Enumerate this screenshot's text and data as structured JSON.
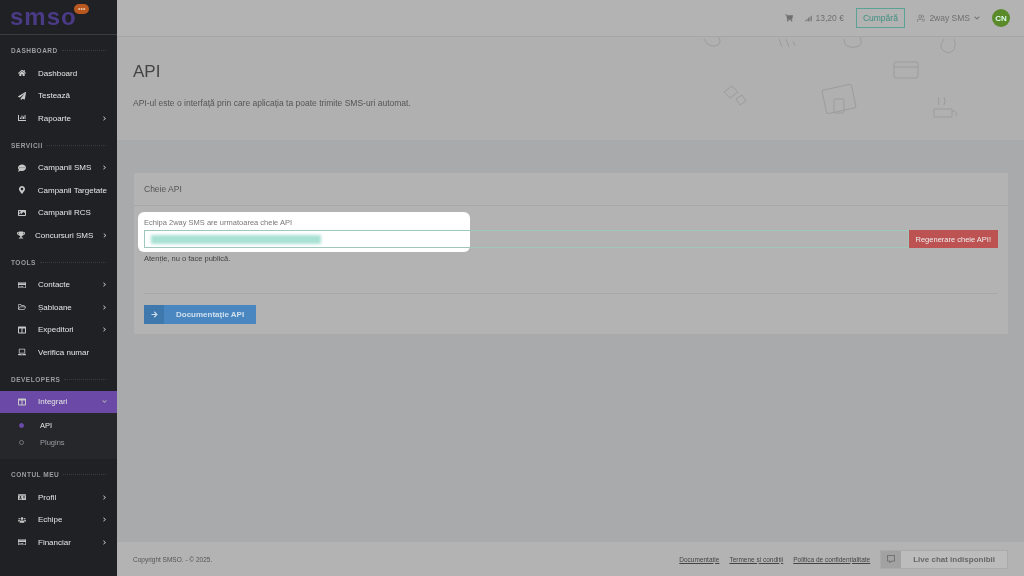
{
  "logo": {
    "text": "smso",
    "badge": "•••"
  },
  "sidebar": {
    "sections": [
      {
        "title": "DASHBOARD",
        "items": [
          {
            "label": "Dashboard",
            "arrow": false,
            "selected": false
          },
          {
            "label": "Testează",
            "arrow": false,
            "selected": false
          },
          {
            "label": "Rapoarte",
            "arrow": true,
            "selected": false
          }
        ]
      },
      {
        "title": "SERVICII",
        "items": [
          {
            "label": "Campanii SMS",
            "arrow": true,
            "selected": false
          },
          {
            "label": "Campanii Targetate",
            "arrow": false,
            "selected": false
          },
          {
            "label": "Campanii RCS",
            "arrow": false,
            "selected": false
          },
          {
            "label": "Concursuri SMS",
            "arrow": true,
            "selected": false
          }
        ]
      },
      {
        "title": "TOOLS",
        "items": [
          {
            "label": "Contacte",
            "arrow": true,
            "selected": false
          },
          {
            "label": "Șabloane",
            "arrow": true,
            "selected": false
          },
          {
            "label": "Expeditori",
            "arrow": true,
            "selected": false
          },
          {
            "label": "Verifica numar",
            "arrow": false,
            "selected": false
          }
        ]
      },
      {
        "title": "DEVELOPERS",
        "items": [
          {
            "label": "Integrari",
            "arrow": true,
            "selected": true,
            "expanded": true,
            "children": [
              {
                "label": "API",
                "selected": true
              },
              {
                "label": "Plugins",
                "selected": false
              }
            ]
          }
        ]
      },
      {
        "title": "CONTUL MEU",
        "items": [
          {
            "label": "Profil",
            "arrow": true,
            "selected": false
          },
          {
            "label": "Echipe",
            "arrow": true,
            "selected": false
          },
          {
            "label": "Financiar",
            "arrow": true,
            "selected": false
          }
        ]
      }
    ]
  },
  "topbar": {
    "balance": "13,20 €",
    "buy": "Cumpără",
    "team": "2way SMS",
    "avatar": "CN"
  },
  "header": {
    "title": "API",
    "subtitle": "API-ul este o interfață prin care aplicația ta poate trimite SMS-uri automat."
  },
  "card": {
    "title": "Cheie API",
    "field_label": "Echipa 2way SMS are urmatoarea cheie API",
    "regenerate": "Regenerare cheie API!",
    "warning": "Atenție, nu o face publică.",
    "docs_button": "Documentație API"
  },
  "footer": {
    "copyright": "Copyright SMSO. - © 2025.",
    "links": [
      "Documentație",
      "Termene și condiții",
      "Politica de confidențialitate"
    ],
    "chat": "Live chat indisponibil"
  }
}
